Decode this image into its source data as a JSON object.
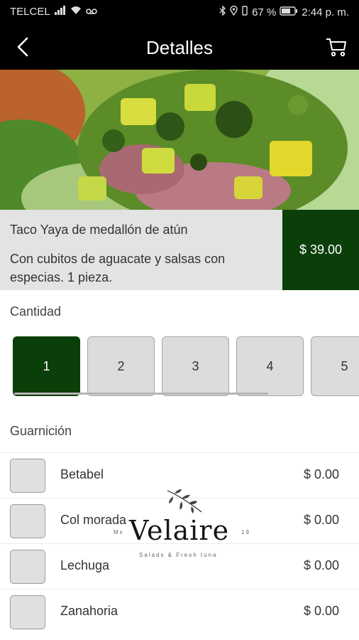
{
  "status_bar": {
    "carrier": "TELCEL",
    "battery": "67 %",
    "time": "2:44 p. m.",
    "icons": [
      "signal-icon",
      "wifi-icon",
      "voicemail-icon",
      "bluetooth-icon",
      "location-icon",
      "vibrate-icon",
      "battery-icon"
    ]
  },
  "header": {
    "title": "Detalles",
    "back_icon": "chevron-left-icon",
    "cart_icon": "cart-icon"
  },
  "product": {
    "name": "Taco Yaya de medallón de atún",
    "description": "Con cubitos de aguacate y salsas con especias. 1 pieza.",
    "price": "$ 39.00"
  },
  "quantity": {
    "label": "Cantidad",
    "options": [
      "1",
      "2",
      "3",
      "4",
      "5"
    ],
    "selected": "1"
  },
  "garnish": {
    "label": "Guarnición",
    "items": [
      {
        "name": "Betabel",
        "price": "$ 0.00"
      },
      {
        "name": "Col morada",
        "price": "$ 0.00"
      },
      {
        "name": "Lechuga",
        "price": "$ 0.00"
      },
      {
        "name": "Zanahoria",
        "price": "$ 0.00"
      }
    ]
  },
  "watermark": {
    "brand": "Velaire",
    "tagline": "Salads & Fresh tuna",
    "left_mark": "Mx",
    "right_mark": "19"
  },
  "colors": {
    "bar_background": "#000000",
    "accent_green": "#0b3f0a",
    "info_background": "#e3e3e3"
  }
}
